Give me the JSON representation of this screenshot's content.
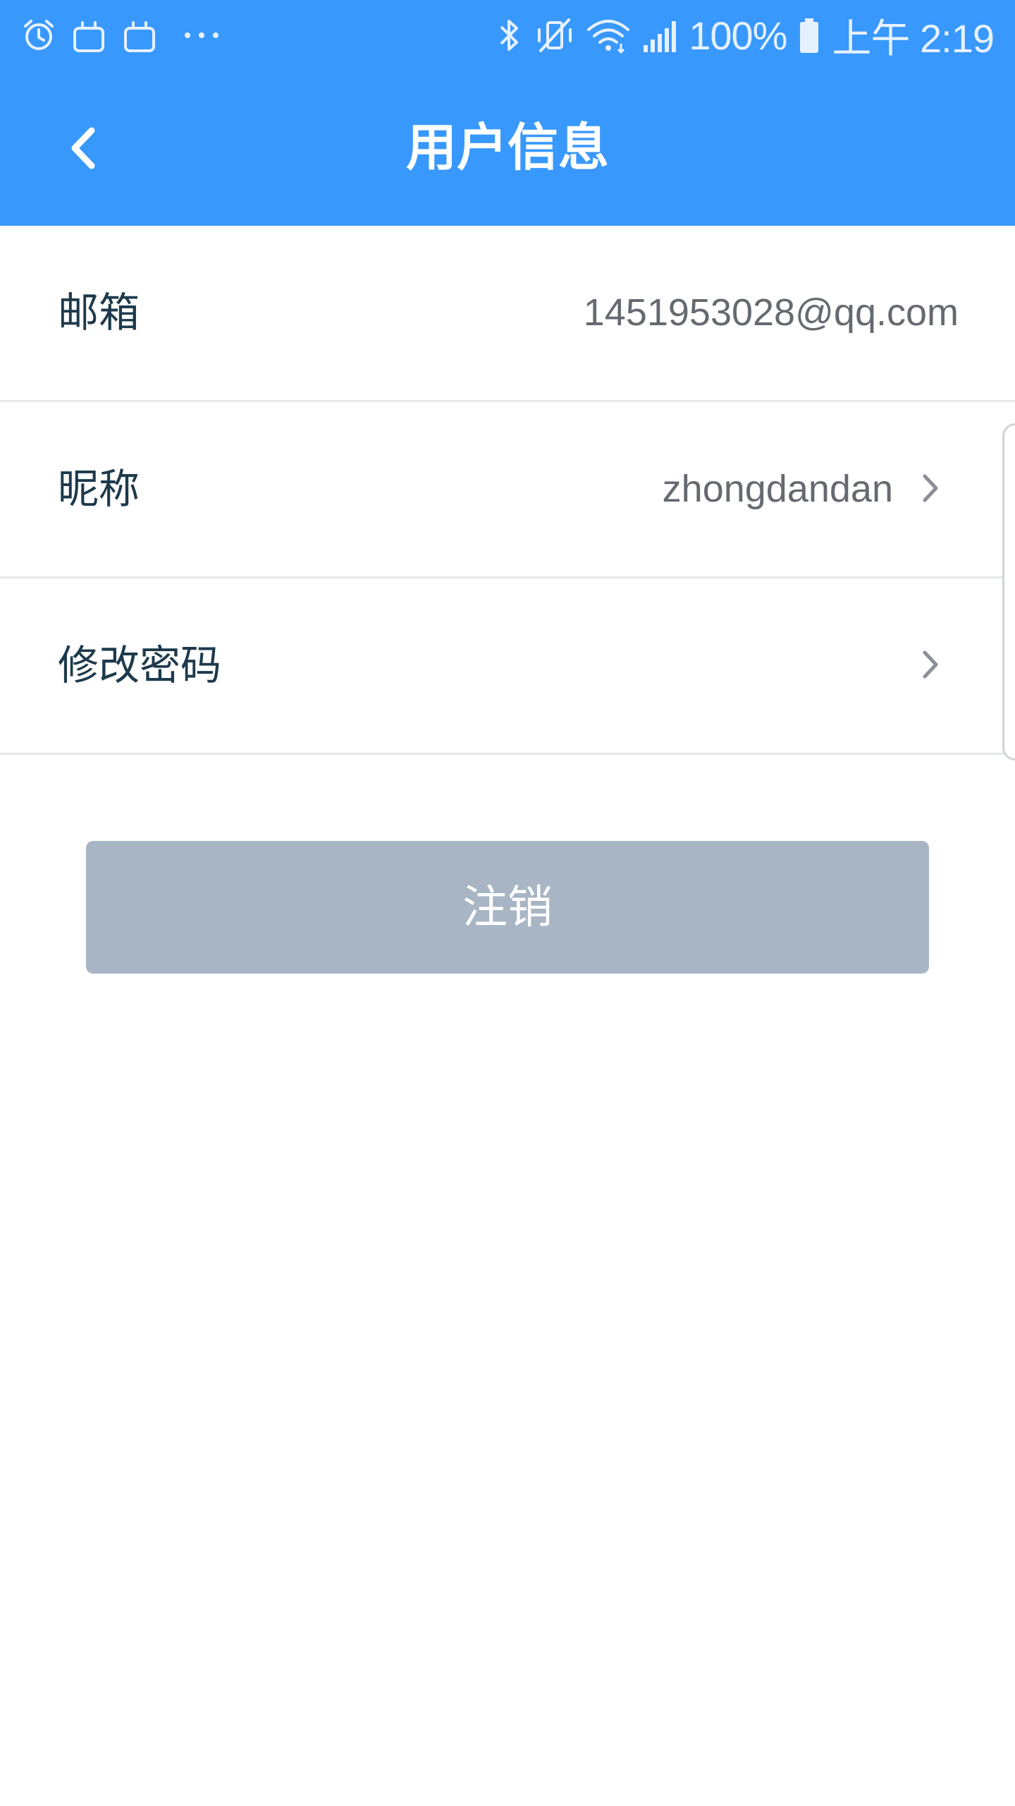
{
  "status_bar": {
    "left_icons": [
      "alarm-icon",
      "bag-icon",
      "bag-icon",
      "more-dots-icon"
    ],
    "right_icons": [
      "bluetooth-icon",
      "vibrate-mute-icon",
      "wifi-icon",
      "signal-icon",
      "battery-icon"
    ],
    "battery": "100%",
    "time": "上午 2:19"
  },
  "header": {
    "title": "用户信息",
    "back_icon": "chevron-left-icon",
    "background_color": "#3898fc"
  },
  "rows": [
    {
      "label": "邮箱",
      "value": "1451953028@qq.com",
      "has_chevron": false
    },
    {
      "label": "昵称",
      "value": "zhongdandan",
      "has_chevron": true
    },
    {
      "label": "修改密码",
      "value": "",
      "has_chevron": true
    }
  ],
  "logout": {
    "label": "注销",
    "color": "#a8b5c4"
  }
}
